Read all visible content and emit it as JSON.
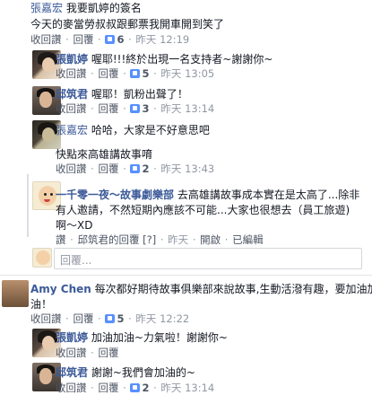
{
  "comments": [
    {
      "name": "張嘉宏",
      "text": "我要凱婷的簽名",
      "text2": "今天的麥當勞叔叔跟郵票我開車開到笑了",
      "reply_action": "回覆",
      "likes": "6",
      "time": "昨天 12:19"
    },
    {
      "name": "張凱婷",
      "text": "喔耶!!!終於出現一名支持者~謝謝你~",
      "reply_action": "回覆",
      "likes": "5",
      "time": "昨天 13:05"
    },
    {
      "name": "邱筑君",
      "text": "喔耶！凱粉出聲了！",
      "reply_action": "回覆",
      "likes": "3",
      "time": "昨天 13:14"
    },
    {
      "name": "張嘉宏",
      "text": "哈哈，大家是不好意思吧",
      "text2": "快點來高雄講故事唷",
      "reply_action": "回覆",
      "likes": "2",
      "time": "昨天 13:43"
    },
    {
      "name": "一千零一夜～故事劇樂部",
      "text": "去高雄講故事成本實在是太高了...除非",
      "text2": "有人邀請，不然短期內應該不可能...大家也很想去（員工旅遊)",
      "text3": "啊～XD",
      "reply_action": "讚",
      "meta_extra": "邱筑君的回覆 [?]",
      "time": "昨天",
      "edited": "已編輯"
    },
    {
      "name": "Amy Chen",
      "text": "每次都好期待故事俱樂部來說故事,生動活潑有趣，要加油加",
      "text2": "油！",
      "reply_action": "回覆",
      "likes": "5",
      "time": "昨天 12:22"
    },
    {
      "name": "張凱婷",
      "text": "加油加油~力氣啦！謝謝你~",
      "reply_action": "回覆",
      "likes": "",
      "time": ""
    },
    {
      "name": "邱筑君",
      "text": "謝謝~我們會加油的~",
      "reply_action": "回覆",
      "likes": "2",
      "time": "昨天 13:14"
    }
  ],
  "meta": {
    "like_action": "收回讚",
    "like": "讚",
    "open": "開啟",
    "sep": "·"
  },
  "compose": {
    "placeholder": "回覆..."
  }
}
